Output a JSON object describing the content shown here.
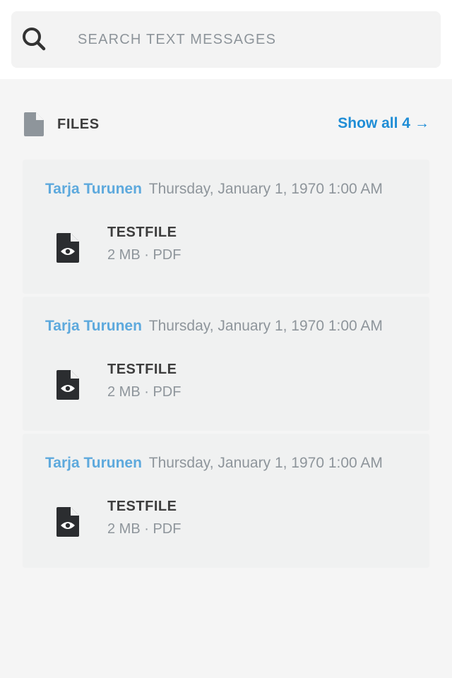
{
  "search": {
    "placeholder": "SEARCH TEXT MESSAGES",
    "icon": "search-icon"
  },
  "files_section": {
    "title": "FILES",
    "icon": "document-icon",
    "show_all_label": "Show all 4",
    "show_all_arrow": "→"
  },
  "colors": {
    "accent": "#1f8dd6",
    "author": "#5da9dd",
    "muted": "#8e959b",
    "dark": "#3d3d3d",
    "card_bg": "#f0f1f1"
  },
  "files": [
    {
      "author": "Tarja Turunen",
      "date": "Thursday, January 1, 1970 1:00 AM",
      "name": "TESTFILE",
      "info": "2 MB · PDF",
      "icon": "pdf-file-icon"
    },
    {
      "author": "Tarja Turunen",
      "date": "Thursday, January 1, 1970 1:00 AM",
      "name": "TESTFILE",
      "info": "2 MB · PDF",
      "icon": "pdf-file-icon"
    },
    {
      "author": "Tarja Turunen",
      "date": "Thursday, January 1, 1970 1:00 AM",
      "name": "TESTFILE",
      "info": "2 MB · PDF",
      "icon": "pdf-file-icon"
    }
  ]
}
